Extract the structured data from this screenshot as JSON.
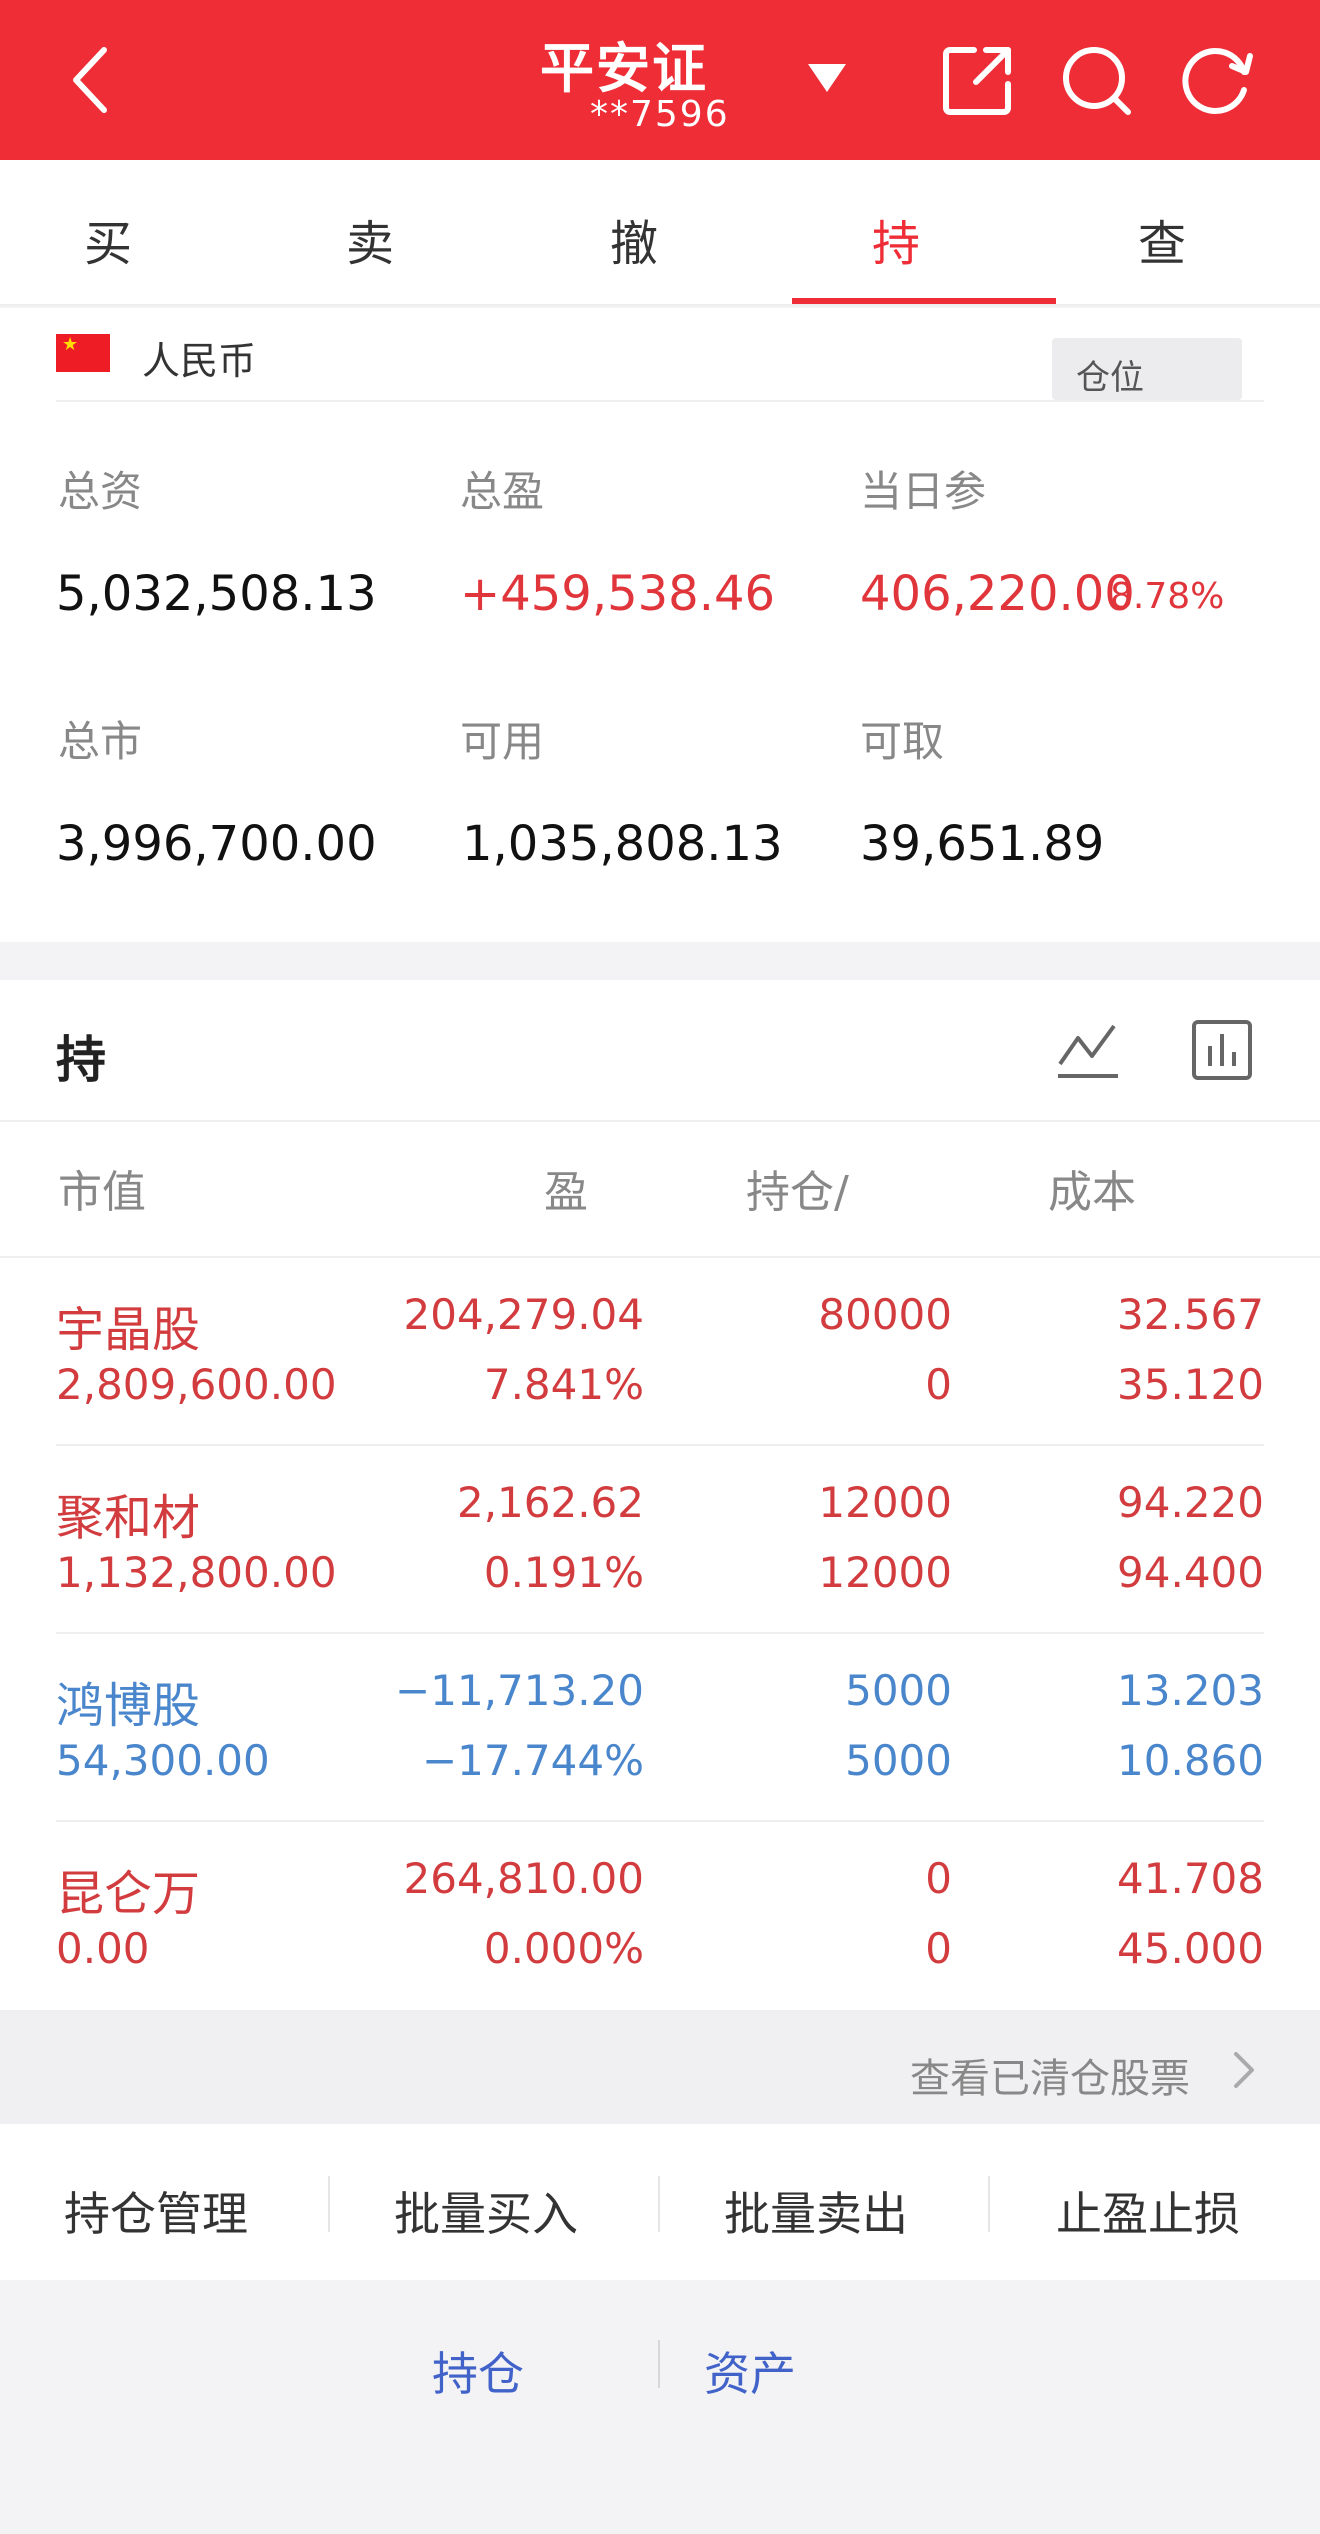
{
  "header": {
    "title": "平安证",
    "account": "**7596",
    "icons": [
      "back-arrow-icon",
      "chevron-down-icon",
      "share-icon",
      "search-icon",
      "refresh-icon"
    ]
  },
  "tabs": [
    {
      "label": "买"
    },
    {
      "label": "卖"
    },
    {
      "label": "撤"
    },
    {
      "label": "持",
      "active": true
    },
    {
      "label": "查"
    }
  ],
  "account_card": {
    "currency_label": "人民币",
    "position_button": "仓位",
    "stats": [
      {
        "label": "总资",
        "value": "5,032,508.13"
      },
      {
        "label": "总盈",
        "value": "+459,538.46"
      },
      {
        "label": "当日参",
        "value": "406,220.00",
        "pct": "8.78%"
      },
      {
        "label": "总市",
        "value": "3,996,700.00"
      },
      {
        "label": "可用",
        "value": "1,035,808.13"
      },
      {
        "label": "可取",
        "value": "39,651.89"
      }
    ]
  },
  "holdings": {
    "title": "持",
    "columns": [
      "市值",
      "盈",
      "持仓/",
      "成本"
    ],
    "rows": [
      {
        "name": "宇晶股",
        "market_value": "2,809,600.00",
        "pl": "204,279.04",
        "pl_pct": "7.841%",
        "qty": "80000",
        "avail": "0",
        "cost": "32.567",
        "price": "35.120",
        "color": "red"
      },
      {
        "name": "聚和材",
        "market_value": "1,132,800.00",
        "pl": "2,162.62",
        "pl_pct": "0.191%",
        "qty": "12000",
        "avail": "12000",
        "cost": "94.220",
        "price": "94.400",
        "color": "red"
      },
      {
        "name": "鸿博股",
        "market_value": "54,300.00",
        "pl": "−11,713.20",
        "pl_pct": "−17.744%",
        "qty": "5000",
        "avail": "5000",
        "cost": "13.203",
        "price": "10.860",
        "color": "blue"
      },
      {
        "name": "昆仑万",
        "market_value": "0.00",
        "pl": "264,810.00",
        "pl_pct": "0.000%",
        "qty": "0",
        "avail": "0",
        "cost": "41.708",
        "price": "45.000",
        "color": "red"
      }
    ],
    "cleared_link": "查看已清仓股票"
  },
  "bottom_actions": [
    "持仓管理",
    "批量买入",
    "批量卖出",
    "止盈止损"
  ],
  "footer_links": [
    "持仓",
    "资产"
  ],
  "colors": {
    "brand_red": "#ee2d36",
    "gain_red": "#d23c3f",
    "loss_blue": "#4a86cc",
    "link_blue": "#4162c8"
  }
}
